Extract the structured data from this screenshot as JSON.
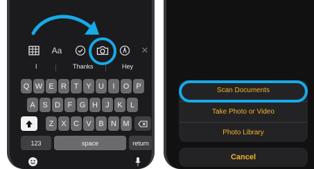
{
  "left_phone": {
    "predictions": [
      "I",
      "Thanks",
      "Hey"
    ],
    "keys": {
      "row1": [
        "Q",
        "W",
        "E",
        "R",
        "T",
        "Y",
        "U",
        "I",
        "O",
        "P"
      ],
      "row2": [
        "A",
        "S",
        "D",
        "F",
        "G",
        "H",
        "J",
        "K",
        "L"
      ],
      "row3": [
        "Z",
        "X",
        "C",
        "V",
        "B",
        "N",
        "M"
      ],
      "numbers": "123",
      "space": "space",
      "return": "return"
    },
    "toolbar": {
      "format_label": "Aa"
    }
  },
  "right_phone": {
    "menu": [
      "Scan Documents",
      "Take Photo or Video",
      "Photo Library"
    ],
    "cancel": "Cancel"
  },
  "colors": {
    "highlight": "#17a9e8",
    "menu_text": "#f5b32a"
  },
  "icons": [
    "table-icon",
    "checklist-icon",
    "camera-icon",
    "markup-icon",
    "close-icon",
    "shift-icon",
    "delete-icon",
    "emoji-icon",
    "microphone-icon",
    "curved-arrow-icon"
  ]
}
